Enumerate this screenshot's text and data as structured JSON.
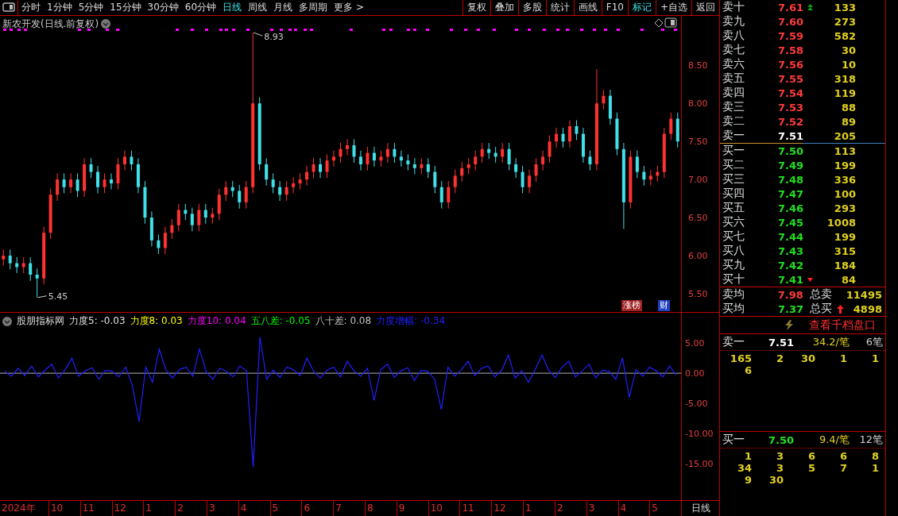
{
  "toolbar": {
    "periods": [
      {
        "label": "分时",
        "selected": false
      },
      {
        "label": "1分钟",
        "selected": false
      },
      {
        "label": "5分钟",
        "selected": false
      },
      {
        "label": "15分钟",
        "selected": false
      },
      {
        "label": "30分钟",
        "selected": false
      },
      {
        "label": "60分钟",
        "selected": false
      },
      {
        "label": "日线",
        "selected": true
      },
      {
        "label": "周线",
        "selected": false
      },
      {
        "label": "月线",
        "selected": false
      },
      {
        "label": "多周期",
        "selected": false
      },
      {
        "label": "更多 >",
        "selected": false
      }
    ],
    "buttons": [
      {
        "label": "复权",
        "selected": false
      },
      {
        "label": "叠加",
        "selected": false
      },
      {
        "label": "多股",
        "selected": false
      },
      {
        "label": "统计",
        "selected": false
      },
      {
        "label": "画线",
        "selected": false
      },
      {
        "label": "F10",
        "selected": false
      },
      {
        "label": "标记",
        "selected": true
      },
      {
        "label": "+自选",
        "selected": false
      },
      {
        "label": "返回",
        "selected": false
      }
    ]
  },
  "price_chart": {
    "title": "新农开发(日线.前复权)",
    "badges": [
      {
        "label": "涨榜",
        "color": "#a02020"
      },
      {
        "label": "财",
        "color": "#2040c0"
      }
    ],
    "extremes": [
      {
        "label": "8.93",
        "kind": "high"
      },
      {
        "label": "5.45",
        "kind": "low"
      }
    ],
    "chart_data": {
      "type": "candlestick",
      "categories": [
        null,
        null,
        null,
        null,
        null,
        null,
        null,
        null,
        null,
        null,
        null,
        null,
        null,
        null,
        null,
        null,
        null,
        null,
        null,
        null,
        null,
        null,
        null,
        null,
        null,
        null,
        null,
        null,
        null,
        null,
        null,
        null,
        null,
        null,
        null,
        null,
        null,
        null,
        null,
        null,
        null,
        null,
        null,
        null,
        null,
        null,
        null,
        null,
        null,
        null,
        null,
        null,
        null,
        null,
        null,
        null,
        null,
        null,
        null,
        null,
        null,
        null,
        null,
        null,
        null,
        null,
        null,
        null,
        null,
        null,
        null,
        null,
        null,
        null,
        null,
        null,
        null,
        null,
        null,
        null,
        null,
        null,
        null,
        null,
        null,
        null,
        null,
        null,
        null,
        null,
        null,
        null,
        null,
        null,
        null,
        null,
        null,
        null,
        null,
        null,
        null
      ],
      "ylim": [
        5.27,
        9.15
      ],
      "yticks": [
        {
          "value": 5.5,
          "label": "5.50"
        },
        {
          "value": 6,
          "label": "6.00"
        },
        {
          "value": 6.5,
          "label": "6.50"
        },
        {
          "value": 7,
          "label": "7.00"
        },
        {
          "value": 7.5,
          "label": "7.50"
        },
        {
          "value": 8,
          "label": "8.00"
        },
        {
          "value": 8.5,
          "label": "8.50"
        }
      ],
      "ohlc": [
        [
          5.95,
          6.08,
          5.87,
          6.0
        ],
        [
          6.0,
          6.08,
          5.82,
          5.9
        ],
        [
          5.9,
          5.98,
          5.77,
          5.85
        ],
        [
          5.85,
          5.98,
          5.77,
          5.9
        ],
        [
          5.9,
          5.98,
          5.67,
          5.75
        ],
        [
          5.75,
          5.83,
          5.45,
          5.7
        ],
        [
          5.7,
          6.38,
          5.62,
          6.3
        ],
        [
          6.3,
          6.88,
          6.22,
          6.8
        ],
        [
          6.8,
          7.08,
          6.72,
          7.0
        ],
        [
          7.0,
          7.08,
          6.82,
          6.9
        ],
        [
          6.9,
          7.08,
          6.82,
          7.0
        ],
        [
          7.0,
          7.08,
          6.77,
          6.85
        ],
        [
          6.85,
          7.28,
          6.77,
          7.2
        ],
        [
          7.2,
          7.28,
          7.02,
          7.1
        ],
        [
          7.1,
          7.18,
          6.82,
          6.9
        ],
        [
          6.9,
          7.08,
          6.82,
          7.0
        ],
        [
          7.0,
          7.08,
          6.87,
          6.95
        ],
        [
          6.95,
          7.28,
          6.87,
          7.2
        ],
        [
          7.2,
          7.38,
          7.12,
          7.3
        ],
        [
          7.3,
          7.38,
          7.12,
          7.2
        ],
        [
          7.2,
          7.28,
          6.82,
          6.9
        ],
        [
          6.9,
          6.98,
          6.42,
          6.5
        ],
        [
          6.5,
          6.58,
          6.12,
          6.2
        ],
        [
          6.2,
          6.28,
          6.02,
          6.1
        ],
        [
          6.1,
          6.38,
          6.02,
          6.3
        ],
        [
          6.3,
          6.48,
          6.22,
          6.4
        ],
        [
          6.4,
          6.68,
          6.32,
          6.6
        ],
        [
          6.6,
          6.68,
          6.47,
          6.55
        ],
        [
          6.55,
          6.63,
          6.32,
          6.4
        ],
        [
          6.4,
          6.68,
          6.32,
          6.6
        ],
        [
          6.6,
          6.68,
          6.42,
          6.5
        ],
        [
          6.5,
          6.63,
          6.42,
          6.55
        ],
        [
          6.55,
          6.88,
          6.47,
          6.8
        ],
        [
          6.8,
          6.98,
          6.72,
          6.9
        ],
        [
          6.9,
          6.98,
          6.77,
          6.85
        ],
        [
          6.85,
          6.93,
          6.62,
          6.7
        ],
        [
          6.7,
          6.98,
          6.62,
          6.9
        ],
        [
          6.9,
          8.93,
          6.82,
          8.0
        ],
        [
          8.0,
          8.08,
          7.12,
          7.2
        ],
        [
          7.2,
          7.28,
          6.92,
          7.0
        ],
        [
          7.0,
          7.08,
          6.82,
          6.9
        ],
        [
          6.9,
          6.98,
          6.72,
          6.8
        ],
        [
          6.8,
          6.98,
          6.72,
          6.9
        ],
        [
          6.9,
          7.03,
          6.82,
          6.95
        ],
        [
          6.95,
          7.08,
          6.87,
          7.0
        ],
        [
          7.0,
          7.18,
          6.92,
          7.1
        ],
        [
          7.1,
          7.28,
          7.02,
          7.2
        ],
        [
          7.2,
          7.28,
          7.02,
          7.1
        ],
        [
          7.1,
          7.33,
          7.02,
          7.25
        ],
        [
          7.25,
          7.38,
          7.17,
          7.3
        ],
        [
          7.3,
          7.48,
          7.22,
          7.4
        ],
        [
          7.4,
          7.53,
          7.32,
          7.45
        ],
        [
          7.45,
          7.53,
          7.22,
          7.3
        ],
        [
          7.3,
          7.38,
          7.12,
          7.2
        ],
        [
          7.2,
          7.43,
          7.12,
          7.35
        ],
        [
          7.35,
          7.43,
          7.17,
          7.25
        ],
        [
          7.25,
          7.38,
          7.17,
          7.3
        ],
        [
          7.3,
          7.48,
          7.22,
          7.4
        ],
        [
          7.4,
          7.48,
          7.22,
          7.3
        ],
        [
          7.3,
          7.38,
          7.17,
          7.25
        ],
        [
          7.25,
          7.33,
          7.12,
          7.2
        ],
        [
          7.2,
          7.28,
          7.07,
          7.15
        ],
        [
          7.15,
          7.28,
          7.07,
          7.2
        ],
        [
          7.2,
          7.28,
          7.02,
          7.1
        ],
        [
          7.1,
          7.18,
          6.82,
          6.9
        ],
        [
          6.9,
          6.98,
          6.62,
          6.7
        ],
        [
          6.7,
          6.98,
          6.62,
          6.9
        ],
        [
          6.9,
          7.13,
          6.82,
          7.05
        ],
        [
          7.05,
          7.23,
          6.97,
          7.15
        ],
        [
          7.15,
          7.28,
          7.07,
          7.2
        ],
        [
          7.2,
          7.38,
          7.12,
          7.3
        ],
        [
          7.3,
          7.48,
          7.22,
          7.4
        ],
        [
          7.4,
          7.48,
          7.27,
          7.35
        ],
        [
          7.35,
          7.43,
          7.22,
          7.3
        ],
        [
          7.3,
          7.48,
          7.22,
          7.4
        ],
        [
          7.4,
          7.48,
          7.12,
          7.2
        ],
        [
          7.2,
          7.28,
          7.02,
          7.1
        ],
        [
          7.1,
          7.18,
          6.82,
          6.9
        ],
        [
          6.9,
          7.13,
          6.82,
          7.05
        ],
        [
          7.05,
          7.28,
          6.97,
          7.2
        ],
        [
          7.2,
          7.38,
          7.12,
          7.3
        ],
        [
          7.3,
          7.58,
          7.22,
          7.5
        ],
        [
          7.5,
          7.68,
          7.42,
          7.6
        ],
        [
          7.6,
          7.68,
          7.42,
          7.5
        ],
        [
          7.5,
          7.78,
          7.42,
          7.7
        ],
        [
          7.7,
          7.78,
          7.52,
          7.6
        ],
        [
          7.6,
          7.68,
          7.22,
          7.3
        ],
        [
          7.3,
          7.38,
          7.12,
          7.2
        ],
        [
          7.2,
          8.45,
          7.12,
          8.0
        ],
        [
          8.0,
          8.18,
          7.92,
          8.1
        ],
        [
          8.1,
          8.18,
          7.72,
          7.8
        ],
        [
          7.8,
          7.88,
          7.32,
          7.4
        ],
        [
          7.4,
          7.48,
          6.35,
          6.7
        ],
        [
          6.7,
          7.38,
          6.62,
          7.3
        ],
        [
          7.3,
          7.38,
          7.02,
          7.1
        ],
        [
          7.1,
          7.18,
          6.92,
          7.0
        ],
        [
          7.0,
          7.13,
          6.92,
          7.05
        ],
        [
          7.05,
          7.18,
          6.97,
          7.1
        ],
        [
          7.1,
          7.68,
          7.02,
          7.6
        ],
        [
          7.6,
          7.88,
          7.52,
          7.8
        ],
        [
          7.8,
          7.88,
          7.42,
          7.5
        ]
      ]
    }
  },
  "indicator_chart": {
    "title": "股朋指标网",
    "legend": [
      {
        "label": "力度5: -0.03",
        "color": "#e0e0e0"
      },
      {
        "label": "力度8: 0.03",
        "color": "#ffff00"
      },
      {
        "label": "力度10: 0.04",
        "color": "#ff00ff"
      },
      {
        "label": "五八差: -0.05",
        "color": "#00ff00"
      },
      {
        "label": "八十差: 0.08",
        "color": "#c0c0c0"
      },
      {
        "label": "力度增幅: -0.34",
        "color": "#2020ff"
      }
    ],
    "chart_data": {
      "type": "line",
      "categories": [
        null,
        null,
        null,
        null,
        null,
        null,
        null,
        null,
        null,
        null,
        null,
        null,
        null,
        null,
        null,
        null,
        null,
        null,
        null,
        null,
        null,
        null,
        null,
        null,
        null,
        null,
        null,
        null,
        null,
        null,
        null,
        null,
        null,
        null,
        null,
        null,
        null,
        null,
        null,
        null,
        null,
        null,
        null,
        null,
        null,
        null,
        null,
        null,
        null,
        null,
        null,
        null,
        null,
        null,
        null,
        null,
        null,
        null,
        null,
        null,
        null,
        null,
        null,
        null,
        null,
        null,
        null,
        null,
        null,
        null,
        null,
        null,
        null,
        null,
        null,
        null,
        null,
        null,
        null,
        null,
        null,
        null,
        null,
        null,
        null,
        null,
        null,
        null,
        null,
        null,
        null,
        null,
        null,
        null,
        null,
        null,
        null,
        null,
        null,
        null,
        null
      ],
      "ylim": [
        -21,
        10
      ],
      "yticks": [
        {
          "value": 5,
          "label": "5.00"
        },
        {
          "value": 0,
          "label": "0.00"
        },
        {
          "value": -5,
          "label": "-5.00"
        },
        {
          "value": -10,
          "label": "-10.00"
        },
        {
          "value": -15,
          "label": "-15.00"
        }
      ],
      "series": [
        {
          "color": "#2020ff",
          "values": [
            0.3,
            -0.5,
            0.8,
            -0.4,
            1.2,
            -0.6,
            0.5,
            1.5,
            -0.8,
            0.6,
            2.5,
            -0.5,
            0.4,
            0.9,
            -1.0,
            0.5,
            0.3,
            -0.6,
            1.0,
            -2.0,
            -8.0,
            1.0,
            -1.5,
            4.0,
            0.5,
            -0.8,
            0.6,
            1.0,
            -0.5,
            4.0,
            0.2,
            -1.0,
            0.8,
            0.3,
            -0.6,
            1.2,
            0.4,
            -15.5,
            6.0,
            -1.0,
            0.5,
            -0.7,
            1.0,
            0.6,
            -0.4,
            2.5,
            0.3,
            -0.8,
            0.5,
            1.0,
            -0.6,
            2.0,
            0.4,
            -0.5,
            0.8,
            -4.5,
            0.6,
            1.5,
            -0.7,
            0.4,
            0.9,
            -1.2,
            0.5,
            0.3,
            -1.0,
            -6.0,
            1.0,
            -0.5,
            0.6,
            2.0,
            -0.4,
            0.8,
            1.2,
            -0.6,
            0.5,
            3.0,
            -0.8,
            0.4,
            -1.5,
            0.6,
            3.0,
            0.5,
            -0.7,
            1.0,
            2.0,
            -0.6,
            0.4,
            1.5,
            -0.8,
            0.5,
            0.3,
            -1.0,
            2.5,
            -4.0,
            0.6,
            -0.5,
            1.0,
            0.4,
            -0.6,
            1.2,
            -0.3
          ]
        }
      ]
    }
  },
  "x_axis": {
    "labels": [
      "2024年",
      "10",
      "11",
      "12",
      "1",
      "2",
      "3",
      "4",
      "5",
      "6",
      "7",
      "8",
      "9",
      "10",
      "11",
      "12",
      "1",
      "2",
      "3",
      "4",
      "5"
    ],
    "period_label": "日线"
  },
  "order_book": {
    "asks": [
      {
        "label": "卖十",
        "price": "7.61",
        "volume": "133",
        "kind": "up"
      },
      {
        "label": "卖九",
        "price": "7.60",
        "volume": "273",
        "kind": "plain"
      },
      {
        "label": "卖八",
        "price": "7.59",
        "volume": "582",
        "kind": "plain"
      },
      {
        "label": "卖七",
        "price": "7.58",
        "volume": "30",
        "kind": "plain"
      },
      {
        "label": "卖六",
        "price": "7.56",
        "volume": "10",
        "kind": "plain"
      },
      {
        "label": "卖五",
        "price": "7.55",
        "volume": "318",
        "kind": "plain"
      },
      {
        "label": "卖四",
        "price": "7.54",
        "volume": "119",
        "kind": "plain"
      },
      {
        "label": "卖三",
        "price": "7.53",
        "volume": "88",
        "kind": "plain"
      },
      {
        "label": "卖二",
        "price": "7.52",
        "volume": "89",
        "kind": "plain"
      },
      {
        "label": "卖一",
        "price": "7.51",
        "volume": "205",
        "kind": "best"
      }
    ],
    "bids": [
      {
        "label": "买一",
        "price": "7.50",
        "volume": "113",
        "kind": "plain"
      },
      {
        "label": "买二",
        "price": "7.49",
        "volume": "199",
        "kind": "plain"
      },
      {
        "label": "买三",
        "price": "7.48",
        "volume": "336",
        "kind": "plain"
      },
      {
        "label": "买四",
        "price": "7.47",
        "volume": "100",
        "kind": "plain"
      },
      {
        "label": "买五",
        "price": "7.46",
        "volume": "293",
        "kind": "plain"
      },
      {
        "label": "买六",
        "price": "7.45",
        "volume": "1008",
        "kind": "plain"
      },
      {
        "label": "买七",
        "price": "7.44",
        "volume": "199",
        "kind": "plain"
      },
      {
        "label": "买八",
        "price": "7.43",
        "volume": "315",
        "kind": "plain"
      },
      {
        "label": "买九",
        "price": "7.42",
        "volume": "184",
        "kind": "plain"
      },
      {
        "label": "买十",
        "price": "7.41",
        "volume": "84",
        "kind": "down"
      }
    ],
    "summary": [
      {
        "label": "卖均",
        "price": "7.98",
        "kind": "sell",
        "total_label": "总卖",
        "total": "11495",
        "arrow": false
      },
      {
        "label": "买均",
        "price": "7.37",
        "kind": "buy",
        "total_label": "总买",
        "total": "4898",
        "arrow": true
      }
    ],
    "depth_button": "查看千档盘口",
    "queues": [
      {
        "label": "卖一",
        "price": "7.51",
        "kind": "sell",
        "average": "34.2/笔",
        "count": "6笔",
        "orders": [
          [
            "165",
            "2",
            "30",
            "1",
            "1"
          ],
          [
            "6"
          ]
        ]
      },
      {
        "label": "买一",
        "price": "7.50",
        "kind": "buy",
        "average": "9.4/笔",
        "count": "12笔",
        "orders": [
          [
            "1",
            "3",
            "6",
            "6",
            "8"
          ],
          [
            "34",
            "3",
            "5",
            "7",
            "1"
          ],
          [
            "9",
            "30"
          ]
        ]
      }
    ]
  }
}
